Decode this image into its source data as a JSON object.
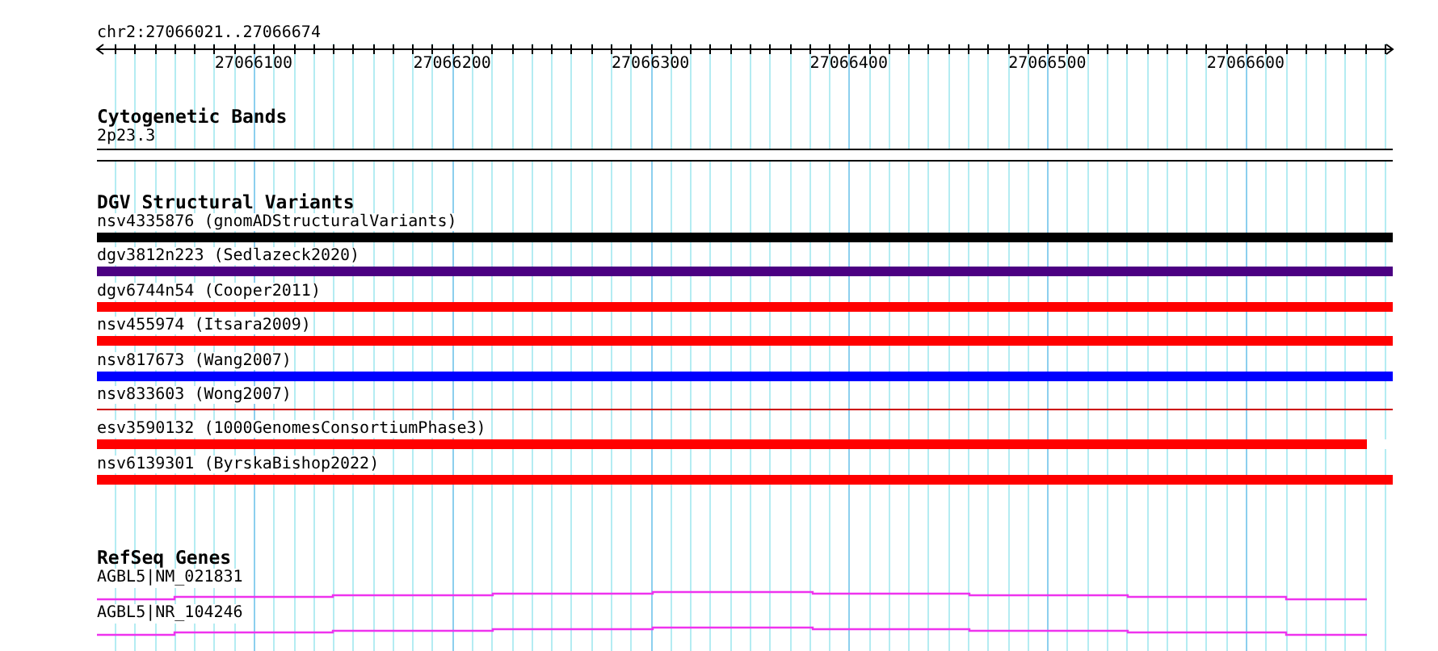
{
  "position": "chr2:27066021..27066674",
  "axis": {
    "tick_labels": [
      "27066100",
      "27066200",
      "27066300",
      "27066400",
      "27066500",
      "27066600"
    ]
  },
  "tracks": [
    {
      "kind": "cytoband",
      "title": "Cytogenetic Bands",
      "band": "2p23.3"
    },
    {
      "kind": "variants",
      "title": "DGV Structural Variants",
      "items": [
        {
          "label": "nsv4335876 (gnomADStructuralVariants)",
          "kind": "bar",
          "color": "#000000"
        },
        {
          "label": "dgv3812n223 (Sedlazeck2020)",
          "kind": "bar",
          "color": "#4b0082"
        },
        {
          "label": "dgv6744n54 (Cooper2011)",
          "kind": "bar",
          "color": "#ff0000"
        },
        {
          "label": "nsv455974 (Itsara2009)",
          "kind": "bar",
          "color": "#ff0000"
        },
        {
          "label": "nsv817673 (Wang2007)",
          "kind": "bar",
          "color": "#0000ff"
        },
        {
          "label": "nsv833603 (Wong2007)",
          "kind": "line",
          "color": "#cc0000"
        },
        {
          "label": "esv3590132 (1000GenomesConsortiumPhase3)",
          "kind": "bar",
          "color": "#ff0000",
          "level": 0.98
        },
        {
          "label": "nsv6139301 (ByrskaBishop2022)",
          "kind": "bar",
          "color": "#ff0000"
        }
      ]
    },
    {
      "kind": "genes",
      "title": "RefSeq Genes",
      "genes": [
        {
          "label": "AGBL5|NM_021831"
        },
        {
          "label": "AGBL5|NR_104246"
        }
      ]
    }
  ]
}
